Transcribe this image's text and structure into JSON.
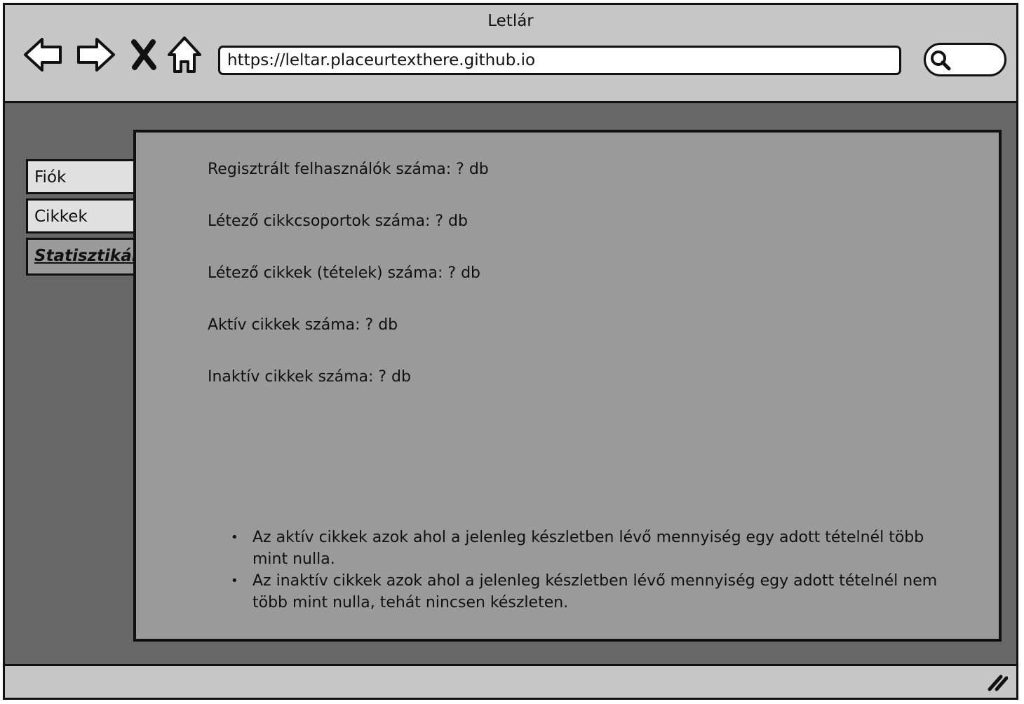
{
  "window": {
    "title": "Letlár"
  },
  "toolbar": {
    "back_icon": "back-arrow-icon",
    "forward_icon": "forward-arrow-icon",
    "stop_icon": "close-icon",
    "home_icon": "home-icon",
    "search_icon": "search-icon"
  },
  "address_bar": {
    "url": "https://leltar.placeurtexthere.github.io"
  },
  "sidebar": {
    "tabs": [
      {
        "label": "Fiók",
        "active": false
      },
      {
        "label": "Cikkek",
        "active": false
      },
      {
        "label": "Statisztikák",
        "active": true
      }
    ]
  },
  "stats": [
    {
      "label": "Regisztrált felhasználók száma: ? db"
    },
    {
      "label": "Létező cikkcsoportok száma: ? db"
    },
    {
      "label": "Létező cikkek (tételek) száma: ? db"
    },
    {
      "label": "Aktív cikkek száma: ? db"
    },
    {
      "label": "Inaktív cikkek száma: ? db"
    }
  ],
  "notes": [
    "Az aktív cikkek azok ahol a jelenleg készletben lévő mennyiség egy adott tételnél több mint nulla.",
    "Az inaktív cikkek azok ahol a jelenleg készletben lévő mennyiség egy adott tételnél nem több mint nulla, tehát nincsen készleten."
  ],
  "colors": {
    "chrome": "#c6c6c6",
    "content_background": "#686868",
    "panel": "#9a9a9a",
    "border": "#111111"
  }
}
